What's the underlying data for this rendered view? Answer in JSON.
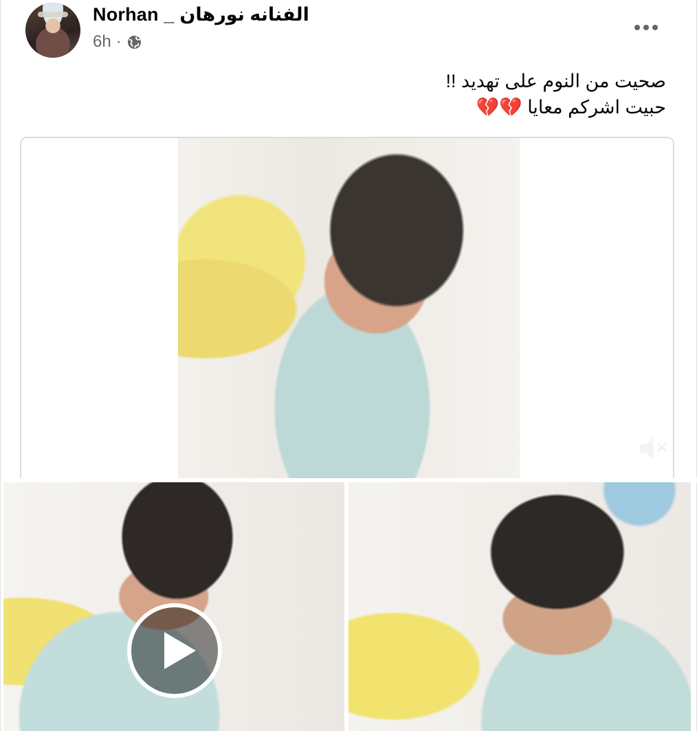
{
  "post": {
    "author": "Norhan _ الفنانه نورهان",
    "time": "6h",
    "audience_icon": "globe-icon",
    "more_icon": "more-options-icon"
  },
  "caption": {
    "line1": "صحيت من النوم على تهديد !!",
    "line2": "حبيت اشركم معايا 💔💔"
  },
  "media": {
    "main_video_icon": "muted-speaker-icon",
    "play_icon": "play-icon"
  },
  "colors": {
    "text_primary": "#050505",
    "text_secondary": "#65676b",
    "border": "#dadde1"
  }
}
